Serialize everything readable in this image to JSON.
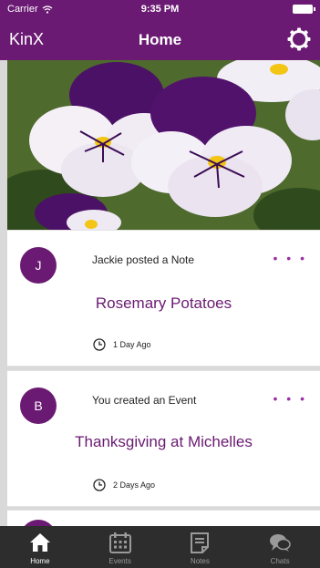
{
  "status_bar": {
    "carrier": "Carrier",
    "time": "9:35 PM"
  },
  "nav": {
    "brand": "KinX",
    "title": "Home"
  },
  "hero": {
    "image": "purple-white-pansies"
  },
  "feed": [
    {
      "avatar_initial": "J",
      "headline": "Jackie posted a Note",
      "title": "Rosemary Potatoes",
      "time": "1 Day Ago"
    },
    {
      "avatar_initial": "B",
      "headline": "You created an Event",
      "title": "Thanksgiving at Michelles",
      "time": "2 Days Ago"
    }
  ],
  "more_glyph": "• • •",
  "tabs": [
    {
      "label": "Home",
      "icon": "home-icon",
      "active": true
    },
    {
      "label": "Events",
      "icon": "calendar-icon",
      "active": false
    },
    {
      "label": "Notes",
      "icon": "note-icon",
      "active": false
    },
    {
      "label": "Chats",
      "icon": "chat-bubbles-icon",
      "active": false
    }
  ],
  "colors": {
    "brand": "#6a1a72",
    "accent": "#9b2ea3",
    "tabbar": "#2d2d2d"
  }
}
